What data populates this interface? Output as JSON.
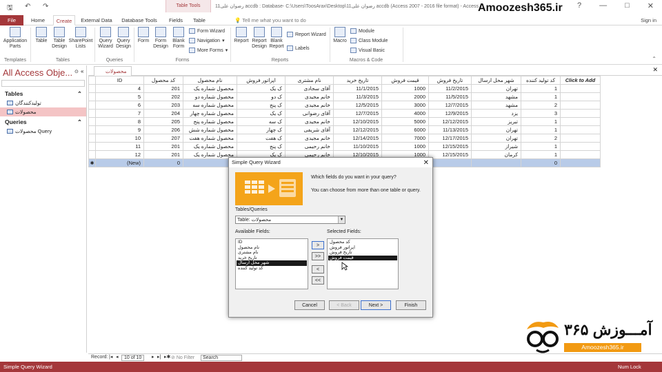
{
  "titlebar": {
    "tab_group": "Table Tools",
    "document_title": "11رضوان علی accdb : Database- C:\\Users\\ToosArax\\Desktop\\11رضوان علی accdb (Access 2007 - 2016 file format) - Access",
    "brand": "Amoozesh365.ir",
    "min": "—",
    "max": "□",
    "close": "✕",
    "help": "?"
  },
  "tabs": {
    "file": "File",
    "home": "Home",
    "create": "Create",
    "external": "External Data",
    "dbtools": "Database Tools",
    "fields": "Fields",
    "table": "Table",
    "tellme": "Tell me what you want to do",
    "signin": "Sign in"
  },
  "ribbon": {
    "templates": {
      "app_parts": "Application Parts",
      "label": "Templates"
    },
    "tables": {
      "table": "Table",
      "design": "Table Design",
      "sharepoint": "SharePoint Lists",
      "label": "Tables"
    },
    "queries": {
      "wizard": "Query Wizard",
      "design": "Query Design",
      "label": "Queries"
    },
    "forms": {
      "form": "Form",
      "design": "Form Design",
      "blank": "Blank Form",
      "wizard": "Form Wizard",
      "navigation": "Navigation",
      "more": "More Forms",
      "label": "Forms"
    },
    "reports": {
      "report": "Report",
      "design": "Report Design",
      "blank": "Blank Report",
      "wizard": "Report Wizard",
      "labels": "Labels",
      "label": "Reports"
    },
    "macros": {
      "macro": "Macro",
      "module": "Module",
      "class": "Class Module",
      "vb": "Visual Basic",
      "label": "Macros & Code"
    }
  },
  "navpane": {
    "title": "All Access Obje...",
    "tables_header": "Tables",
    "tables": [
      "تولیدکنندگان",
      "محصولات"
    ],
    "queries_header": "Queries",
    "queries": [
      "محصولات Query"
    ]
  },
  "datasheet": {
    "tab": "محصولات",
    "headers": [
      "ID",
      "کد محصول",
      "نام محصول",
      "اپراتور فروش",
      "نام مشتری",
      "تاریخ خرید",
      "قیمت فروش",
      "تاریخ فروش",
      "شهر محل ارسال",
      "کد تولید کننده",
      "Click to Add"
    ],
    "rows": [
      [
        "4",
        "201",
        "محصول شماره یک",
        "ک یک",
        "آقای سجادی",
        "11/1/2015",
        "1000",
        "11/2/2015",
        "تهران",
        "1"
      ],
      [
        "5",
        "202",
        "محصول شماره دو",
        "ک دو",
        "خانم مجیدی",
        "11/3/2015",
        "2000",
        "11/5/2015",
        "مشهد",
        "1"
      ],
      [
        "6",
        "203",
        "محصول شماره سه",
        "ک پنج",
        "خانم مجیدی",
        "12/5/2015",
        "3000",
        "12/7/2015",
        "مشهد",
        "2"
      ],
      [
        "7",
        "204",
        "محصول شماره چهار",
        "ک یک",
        "آقای رضوانی",
        "12/7/2015",
        "4000",
        "12/9/2015",
        "یزد",
        "3"
      ],
      [
        "8",
        "205",
        "محصول شماره پنج",
        "ک سه",
        "خانم مجیدی",
        "12/10/2015",
        "5000",
        "12/12/2015",
        "تبریز",
        "1"
      ],
      [
        "9",
        "206",
        "محصول شماره شش",
        "ک چهار",
        "آقای شریفی",
        "12/12/2015",
        "6000",
        "11/13/2015",
        "تهران",
        "1"
      ],
      [
        "10",
        "207",
        "محصول شماره هفت",
        "ک هفت",
        "خانم مجیدی",
        "12/14/2015",
        "7000",
        "12/17/2015",
        "تهران",
        "2"
      ],
      [
        "11",
        "201",
        "محصول شماره یک",
        "ک پنج",
        "خانم رحیمی",
        "11/10/2015",
        "1000",
        "12/15/2015",
        "شیراز",
        "1"
      ],
      [
        "12",
        "201",
        "محصول شماره یک",
        "ک یک",
        "خانم رحیمی",
        "12/10/2015",
        "1000",
        "12/15/2015",
        "کرمان",
        "1"
      ]
    ],
    "new_row": {
      "id": "(New)",
      "code": "0",
      "maker": "0"
    }
  },
  "recnav": {
    "record_label": "Record:",
    "position": "10 of 10",
    "filter": "No Filter",
    "search": "Search"
  },
  "status": {
    "left": "Simple Query Wizard",
    "right": "Num Lock"
  },
  "wizard": {
    "title": "Simple Query Wizard",
    "prompt": "Which fields do you want in your query?",
    "sub": "You can choose from more than one table or query.",
    "tq_label": "Tables/Queries",
    "tq_value": "Table: محصولات",
    "avail_label": "Available Fields:",
    "selected_label": "Selected Fields:",
    "available": [
      "ID",
      "نام محصول",
      "نام مشتری",
      "تاریخ خرید",
      "شهر محل ارسال",
      "کد تولید کننده"
    ],
    "selected": [
      "کد محصول",
      "اپراتور فروش",
      "تاریخ فروش",
      "قیمت فروش"
    ],
    "btn_add": ">",
    "btn_add_all": ">>",
    "btn_remove": "<",
    "btn_remove_all": "<<",
    "cancel": "Cancel",
    "back": "< Back",
    "next": "Next >",
    "finish": "Finish"
  },
  "logo": {
    "text": "آمـــوزش ۳۶۵",
    "url": "Amoozesh365.ir"
  }
}
